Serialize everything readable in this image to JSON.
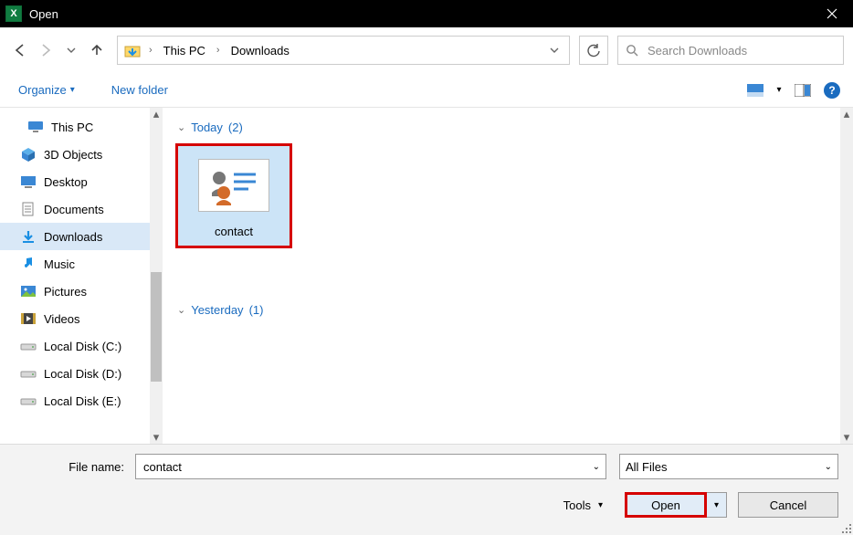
{
  "window": {
    "title": "Open"
  },
  "breadcrumb": {
    "root": "This PC",
    "current": "Downloads"
  },
  "search": {
    "placeholder": "Search Downloads"
  },
  "toolbar": {
    "organize": "Organize",
    "newfolder": "New folder"
  },
  "tree": {
    "root": "This PC",
    "items": [
      {
        "label": "3D Objects"
      },
      {
        "label": "Desktop"
      },
      {
        "label": "Documents"
      },
      {
        "label": "Downloads",
        "selected": true
      },
      {
        "label": "Music"
      },
      {
        "label": "Pictures"
      },
      {
        "label": "Videos"
      },
      {
        "label": "Local Disk (C:)"
      },
      {
        "label": "Local Disk (D:)"
      },
      {
        "label": "Local Disk (E:)"
      }
    ]
  },
  "groups": {
    "today": {
      "label": "Today",
      "count": "(2)",
      "items": [
        {
          "name": "contact"
        }
      ]
    },
    "yesterday": {
      "label": "Yesterday",
      "count": "(1)"
    }
  },
  "bottom": {
    "filename_label": "File name:",
    "filename_value": "contact",
    "filter": "All Files",
    "tools": "Tools",
    "open": "Open",
    "cancel": "Cancel"
  }
}
